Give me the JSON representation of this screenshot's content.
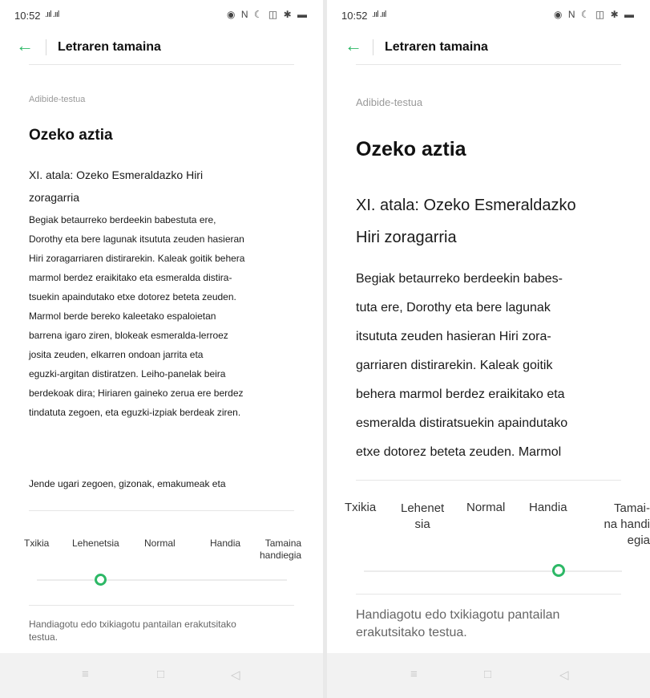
{
  "status_bar": {
    "time": "10:52",
    "signal": ".ııl .ııl",
    "right_icons": "◉ N ☾ ◫ ✱ ▬"
  },
  "app_bar": {
    "title": "Letraren tamaina"
  },
  "preview": {
    "label": "Adibide-testua",
    "heading": "Ozeko aztia",
    "subtitle_small": [
      "XI. atala: Ozeko Esmeraldazko Hiri",
      "zoragarria"
    ],
    "body_small": [
      "Begiak betaurreko berdeekin babestuta ere,",
      "Dorothy eta bere lagunak itsututa zeuden hasieran",
      "Hiri zoragarriaren distirarekin. Kaleak goitik behera",
      "marmol berdez eraikitako eta esmeralda distira-",
      "tsuekin apaindutako etxe dotorez beteta zeuden.",
      "Marmol berde bereko kaleetako espaloietan",
      "barrena igaro ziren, blokeak esmeralda-lerroez",
      "josita zeuden, elkarren ondoan jarrita eta",
      "eguzki-argitan distiratzen. Leiho-panelak beira",
      "berdekoak dira; Hiriaren gaineko zerua ere berdez",
      "tindatuta zegoen, eta eguzki-izpiak berdeak ziren."
    ],
    "body_small_2": "Jende ugari zegoen, gizonak, emakumeak eta",
    "subtitle_large": [
      "XI. atala: Ozeko Esmeraldazko",
      "Hiri zoragarria"
    ],
    "body_large": [
      "Begiak betaurreko berdeekin babes-",
      "tuta ere, Dorothy eta bere lagunak",
      "itsututa zeuden hasieran Hiri zora-",
      "garriaren distirarekin. Kaleak goitik",
      "behera marmol berdez eraikitako eta",
      "esmeralda distiratsuekin apaindutako",
      "etxe dotorez beteta zeuden. Marmol"
    ]
  },
  "sizes_small": {
    "txikia": "Txikia",
    "lehenetsia": "Lehenetsia",
    "normal": "Normal",
    "handia": "Handia",
    "tamaina_handiegia": [
      "Tamaina",
      "handiegia"
    ]
  },
  "sizes_large": {
    "txikia": "Txikia",
    "lehenetsia": [
      "Lehenet",
      "sia"
    ],
    "normal": "Normal",
    "handia": "Handia",
    "tamaina_handiegia": [
      "Tamai-",
      "na handi",
      "egia"
    ]
  },
  "slider": {
    "selected_small": "Lehenetsia",
    "selected_large": "Handia"
  },
  "hint": {
    "small": [
      "Handiagotu edo txikiagotu pantailan erakutsitako",
      "testua."
    ],
    "large": [
      "Handiagotu edo txikiagotu pantailan",
      "erakutsitako testua."
    ]
  },
  "nav_bar": {
    "menu": "≡",
    "home": "□",
    "back": "◁"
  },
  "colors": {
    "accent": "#2db866",
    "navbar_bg": "#f2f2f2",
    "muted_text": "#9a9a9a"
  }
}
